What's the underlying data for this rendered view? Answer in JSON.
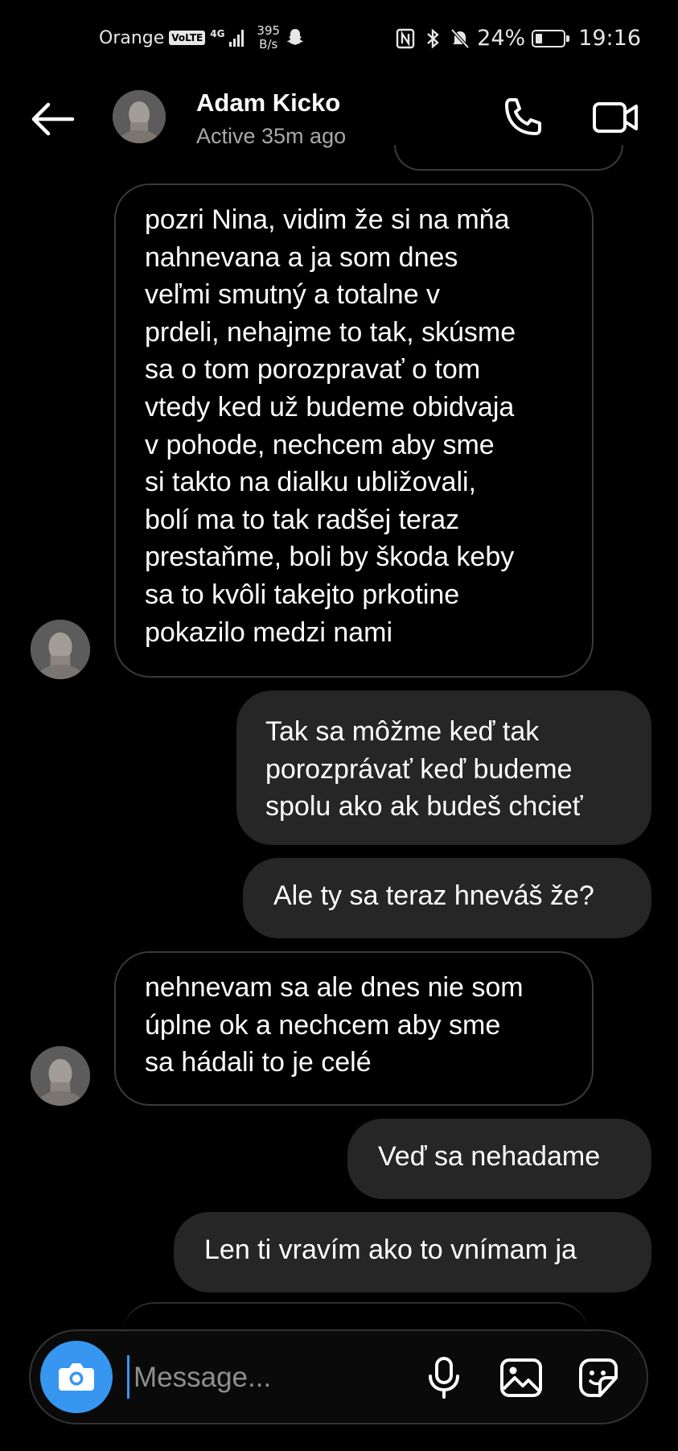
{
  "status_bar": {
    "carrier": "Orange",
    "volte": "VoLTE",
    "network": "4G",
    "speed_value": "395",
    "speed_unit": "B/s",
    "battery": "24%",
    "battery_level": 0.24,
    "time": "19:16"
  },
  "header": {
    "name": "Adam Kicko",
    "status": "Active 35m ago",
    "icons": [
      "back-arrow-icon",
      "phone-icon",
      "video-camera-icon"
    ]
  },
  "messages": [
    {
      "side": "received",
      "text": "pozri Nina, vidim že si na mňa\nnahnevana a ja som dnes\nveľmi smutný a totalne v\nprdeli, nehajme to tak, skúsme\nsa o tom porozpravať o tom\nvtedy ked už budeme obidvaja\nv pohode, nechcem aby sme\nsi takto na dialku ubližovali,\nbolí ma to tak radšej teraz\nprestaňme, boli by škoda keby\nsa to kvôli takejto prkotine\npokazilo medzi nami"
    },
    {
      "side": "sent",
      "text": "Tak sa môžme keď tak\nporozprávať keď budeme\nspolu ako ak budeš chcieť"
    },
    {
      "side": "sent",
      "text": "Ale ty sa teraz hneváš že?"
    },
    {
      "side": "received",
      "text": "nehnevam sa ale dnes nie som\núplne ok a nechcem aby sme\nsa hádali to je celé"
    },
    {
      "side": "sent",
      "text": "Veď sa nehadame"
    },
    {
      "side": "sent",
      "text": "Len ti vravím ako to vnímam ja"
    }
  ],
  "composer": {
    "placeholder": "Message...",
    "icons": [
      "camera-icon",
      "microphone-icon",
      "gallery-icon",
      "sticker-icon"
    ],
    "accent_color": "#3797f0"
  },
  "colors": {
    "background": "#000000",
    "sent_bubble": "#262626",
    "received_border": "#3a3a3a",
    "secondary_text": "#a8a8a8"
  }
}
